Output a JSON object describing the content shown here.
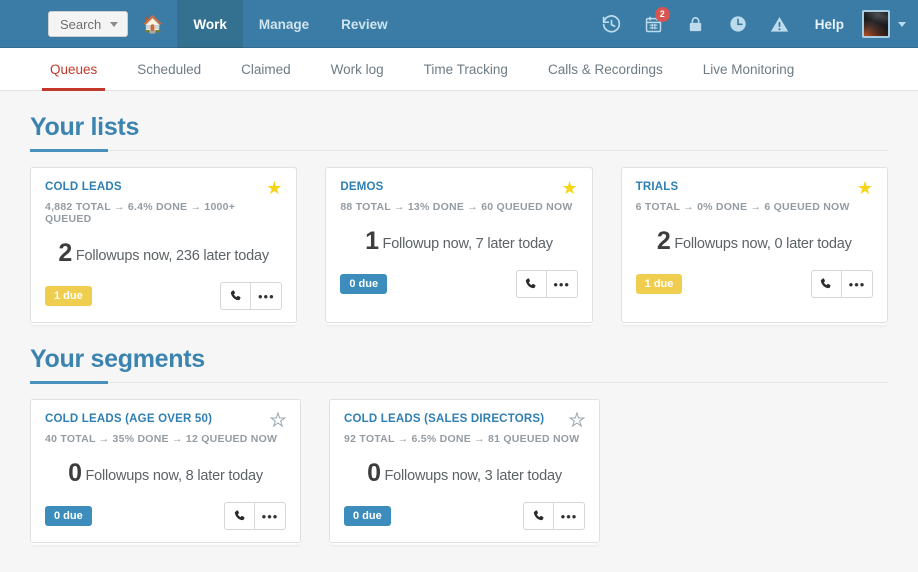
{
  "topnav": {
    "search_label": "Search",
    "home_icon": "home-icon",
    "items": [
      {
        "label": "Work",
        "active": true
      },
      {
        "label": "Manage",
        "active": false
      },
      {
        "label": "Review",
        "active": false
      }
    ],
    "icons": [
      {
        "name": "history-icon"
      },
      {
        "name": "calendar-icon",
        "badge": "2"
      },
      {
        "name": "lock-icon"
      },
      {
        "name": "clock-icon"
      },
      {
        "name": "warning-icon"
      }
    ],
    "help_label": "Help",
    "avatar_alt": "user-avatar"
  },
  "subnav": {
    "items": [
      {
        "label": "Queues",
        "active": true
      },
      {
        "label": "Scheduled",
        "active": false
      },
      {
        "label": "Claimed",
        "active": false
      },
      {
        "label": "Work log",
        "active": false
      },
      {
        "label": "Time Tracking",
        "active": false
      },
      {
        "label": "Calls & Recordings",
        "active": false
      },
      {
        "label": "Live Monitoring",
        "active": false
      }
    ]
  },
  "sections": [
    {
      "title": "Your lists",
      "cards": [
        {
          "title": "COLD LEADS",
          "stats": "4,882 TOTAL → 6.4% DONE → 1000+ QUEUED",
          "count": "2",
          "summary": "Followups now, 236 later today",
          "due_label": "1 due",
          "due_style": "warn",
          "starred": true,
          "call_icon": "phone-icon",
          "more_icon": "ellipsis-icon"
        },
        {
          "title": "DEMOS",
          "stats": "88 TOTAL → 13% DONE → 60 QUEUED NOW",
          "count": "1",
          "summary": "Followup now, 7 later today",
          "due_label": "0 due",
          "due_style": "info",
          "starred": true,
          "call_icon": "phone-icon",
          "more_icon": "ellipsis-icon"
        },
        {
          "title": "TRIALS",
          "stats": "6 TOTAL → 0% DONE → 6 QUEUED NOW",
          "count": "2",
          "summary": "Followups now, 0 later today",
          "due_label": "1 due",
          "due_style": "warn",
          "starred": true,
          "call_icon": "phone-icon",
          "more_icon": "ellipsis-icon"
        }
      ]
    },
    {
      "title": "Your segments",
      "cards": [
        {
          "title": "COLD LEADS (AGE OVER 50)",
          "stats": "40 TOTAL → 35% DONE → 12 QUEUED NOW",
          "count": "0",
          "summary": "Followups now, 8 later today",
          "due_label": "0 due",
          "due_style": "info",
          "starred": false,
          "call_icon": "phone-icon",
          "more_icon": "ellipsis-icon"
        },
        {
          "title": "COLD LEADS (SALES DIRECTORS)",
          "stats": "92 TOTAL → 6.5% DONE → 81 QUEUED NOW",
          "count": "0",
          "summary": "Followups now, 3 later today",
          "due_label": "0 due",
          "due_style": "info",
          "starred": false,
          "call_icon": "phone-icon",
          "more_icon": "ellipsis-icon"
        }
      ]
    }
  ],
  "colors": {
    "topbar": "#3a7ca5",
    "accent_blue": "#3c84b0",
    "active_tab_red": "#c0392b",
    "badge_warn": "#efcd4f",
    "badge_info": "#3c8dbc",
    "star_on": "#f6d417",
    "notification_red": "#d9534f"
  },
  "glyphs": {
    "star_filled": "★",
    "star_outline": "★",
    "dots": "•••"
  }
}
